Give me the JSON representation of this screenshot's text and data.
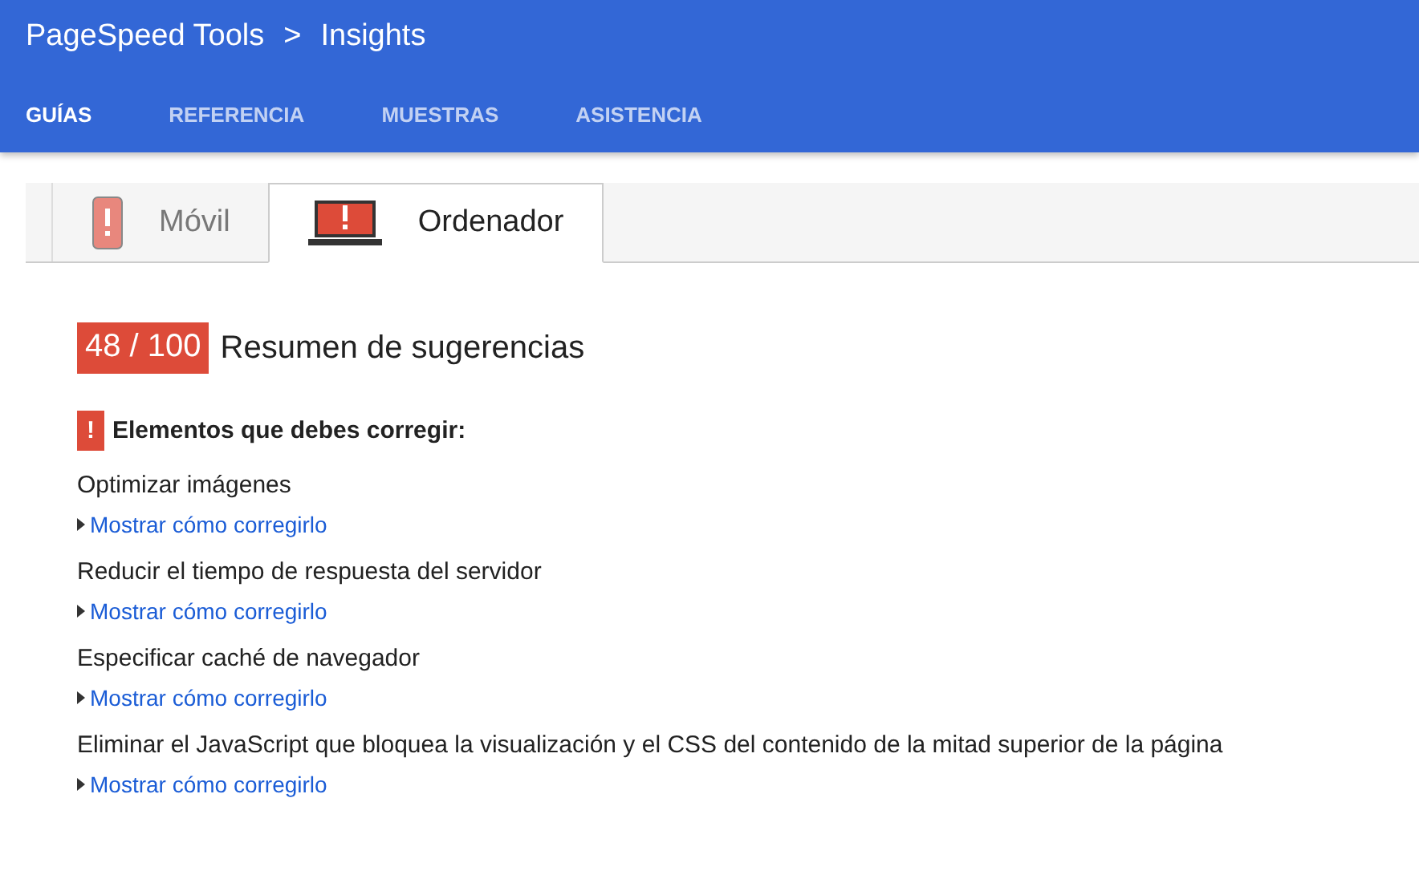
{
  "header": {
    "breadcrumb": [
      "PageSpeed Tools",
      ">",
      "Insights"
    ],
    "nav": [
      {
        "label": "GUÍAS",
        "selected": true
      },
      {
        "label": "REFERENCIA",
        "selected": false
      },
      {
        "label": "MUESTRAS",
        "selected": false
      },
      {
        "label": "ASISTENCIA",
        "selected": false
      }
    ]
  },
  "tabs": [
    {
      "label": "Móvil",
      "kind": "phone",
      "selected": false
    },
    {
      "label": "Ordenador",
      "kind": "laptop",
      "selected": true
    }
  ],
  "summary": {
    "score": "48 / 100",
    "title": "Resumen de sugerencias"
  },
  "section": {
    "badge": "!",
    "title": "Elementos que debes corregir:"
  },
  "rules": [
    {
      "name": "Optimizar imágenes",
      "link": "Mostrar cómo corregirlo"
    },
    {
      "name": "Reducir el tiempo de respuesta del servidor",
      "link": "Mostrar cómo corregirlo"
    },
    {
      "name": "Especificar caché de navegador",
      "link": "Mostrar cómo corregirlo"
    },
    {
      "name": "Eliminar el JavaScript que bloquea la visualización y el CSS del contenido de la mitad superior de la página",
      "link": "Mostrar cómo corregirlo"
    }
  ]
}
